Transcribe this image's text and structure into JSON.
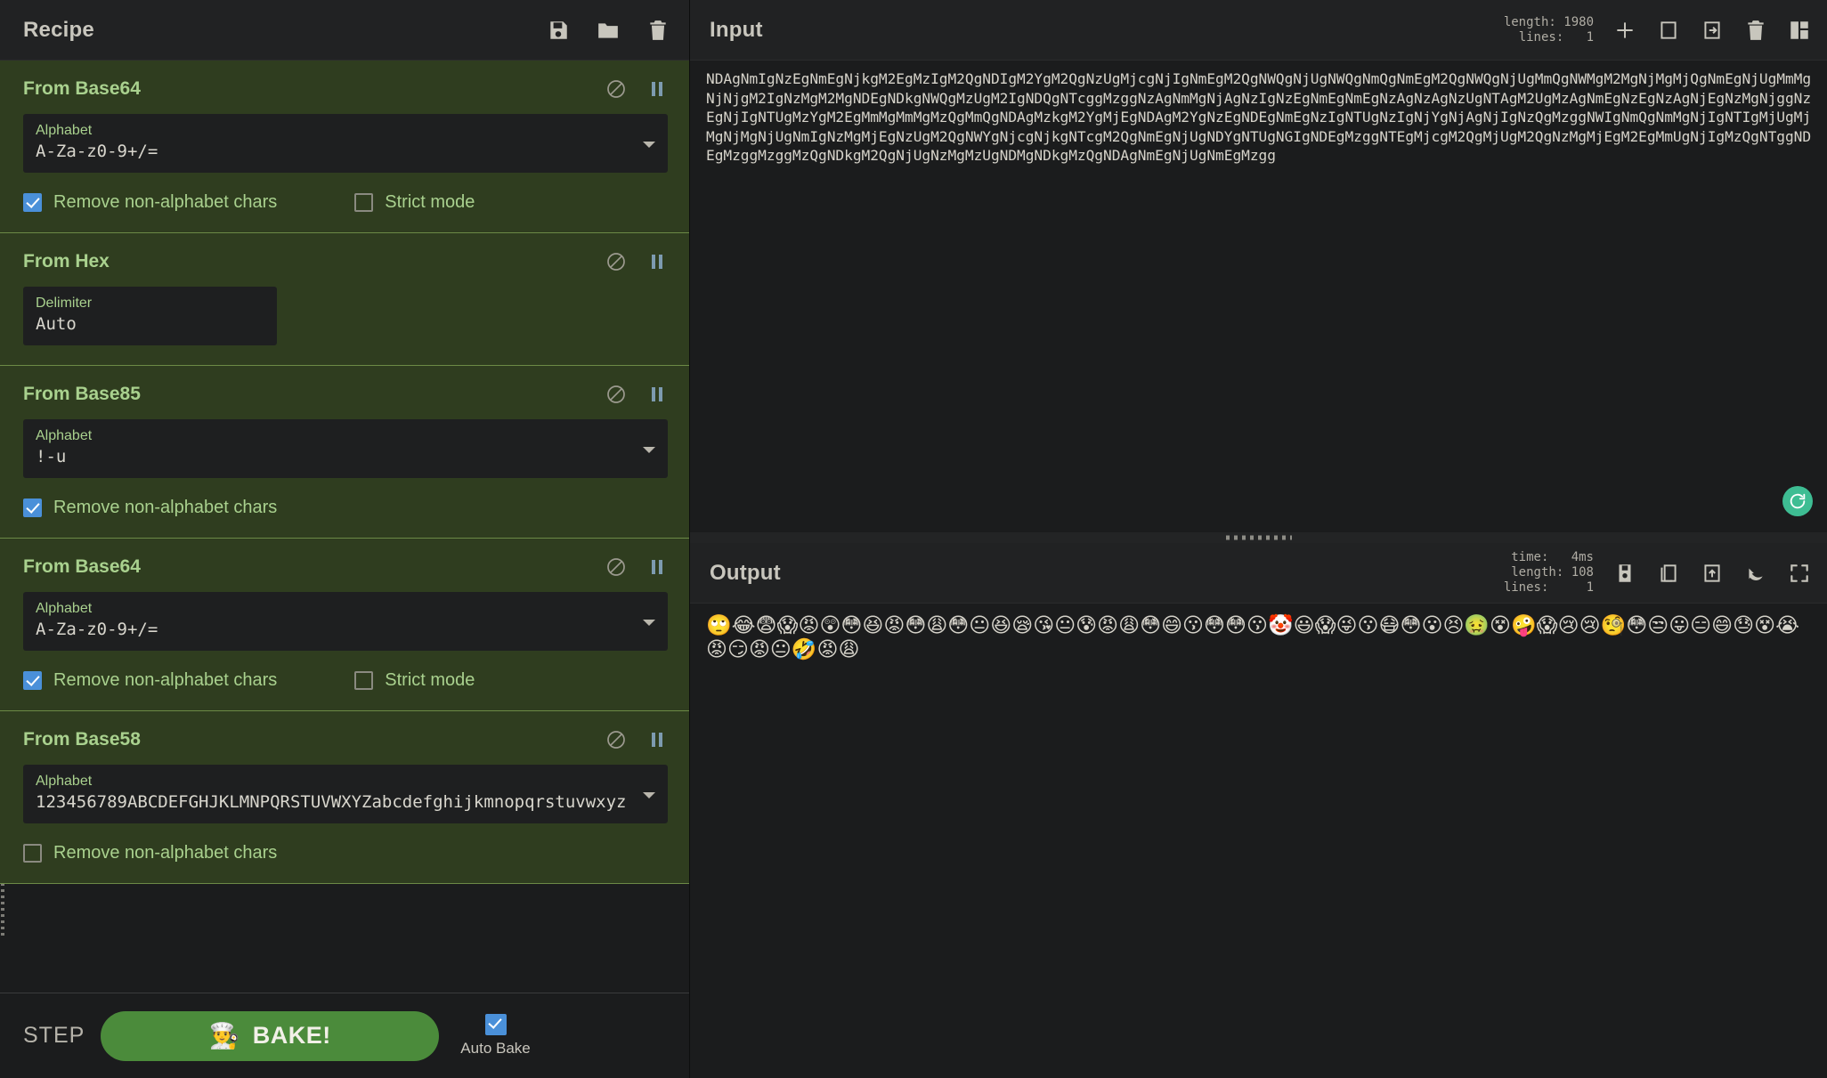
{
  "recipe": {
    "title": "Recipe",
    "header_icons": [
      {
        "name": "save-recipe-icon",
        "glyph": "floppy-disk"
      },
      {
        "name": "load-recipe-icon",
        "glyph": "folder"
      },
      {
        "name": "clear-recipe-icon",
        "glyph": "trash"
      }
    ],
    "operations": [
      {
        "title": "From Base64",
        "disable_icon": "disable-icon",
        "breakpoint_icon": "pause-icon",
        "arg_label": "Alphabet",
        "arg_value": "A-Za-z0-9+/=",
        "has_dropdown": true,
        "checkboxes": [
          {
            "label": "Remove non-alphabet chars",
            "checked": true
          },
          {
            "label": "Strict mode",
            "checked": false
          }
        ]
      },
      {
        "title": "From Hex",
        "disable_icon": "disable-icon",
        "breakpoint_icon": "pause-icon",
        "arg_label": "Delimiter",
        "arg_value": "Auto",
        "has_dropdown": false,
        "checkboxes": []
      },
      {
        "title": "From Base85",
        "disable_icon": "disable-icon",
        "breakpoint_icon": "pause-icon",
        "arg_label": "Alphabet",
        "arg_value": "!-u",
        "has_dropdown": true,
        "checkboxes": [
          {
            "label": "Remove non-alphabet chars",
            "checked": true
          }
        ]
      },
      {
        "title": "From Base64",
        "disable_icon": "disable-icon",
        "breakpoint_icon": "pause-icon",
        "arg_label": "Alphabet",
        "arg_value": "A-Za-z0-9+/=",
        "has_dropdown": true,
        "checkboxes": [
          {
            "label": "Remove non-alphabet chars",
            "checked": true
          },
          {
            "label": "Strict mode",
            "checked": false
          }
        ]
      },
      {
        "title": "From Base58",
        "disable_icon": "disable-icon",
        "breakpoint_icon": "pause-icon",
        "arg_label": "Alphabet",
        "arg_value": "123456789ABCDEFGHJKLMNPQRSTUVWXYZabcdefghijkmnopqrstuvwxyz",
        "has_dropdown": true,
        "checkboxes": [
          {
            "label": "Remove non-alphabet chars",
            "checked": false
          }
        ]
      }
    ],
    "controls": {
      "step_label": "STEP",
      "bake_label": "BAKE!",
      "bake_emoji": "👨‍🍳",
      "autobake_label": "Auto Bake",
      "autobake_checked": true
    }
  },
  "input": {
    "title": "Input",
    "meta": {
      "length_label": "length:",
      "length_value": "1980",
      "lines_label": "lines:",
      "lines_value": "1"
    },
    "icons": [
      {
        "name": "add-input-tab-icon",
        "glyph": "plus"
      },
      {
        "name": "open-folder-icon",
        "glyph": "folder"
      },
      {
        "name": "open-file-as-input-icon",
        "glyph": "file-in"
      },
      {
        "name": "clear-io-icon",
        "glyph": "trash"
      },
      {
        "name": "reset-pane-layout-icon",
        "glyph": "layout"
      }
    ],
    "text": "NDAgNmIgNzEgNmEgNjkgM2EgMzIgM2QgNDIgM2YgM2QgNzUgMjcgNjIgNmEgM2QgNWQgNjUgNWQgNmQgNmEgM2QgNWQgNjUgMmQgNWMgM2MgNjMgMjQgNmEgNjUgMmMgNjNjgM2IgNzMgM2MgNDEgNDkgNWQgMzUgM2IgNDQgNTcggMzggNzAgNmMgNjAgNzIgNzEgNmEgNmEgNzAgNzAgNzUgNTAgM2UgMzAgNmEgNzEgNzAgNjEgNzMgNjggNzEgNjIgNTUgMzYgM2EgMmMgMmMgMzQgMmQgNDAgMzkgM2YgMjEgNDAgM2YgNzEgNDEgNmEgNzIgNTUgNzIgNjYgNjAgNjIgNzQgMzggNWIgNmQgNmMgNjIgNTIgMjUgMjMgNjMgNjUgNmIgNzMgMjEgNzUgM2QgNWYgNjcgNjkgNTcgM2QgNmEgNjUgNDYgNTUgNGIgNDEgMzggNTEgMjcgM2QgMjUgM2QgNzMgMjEgM2EgMmUgNjIgMzQgNTggNDEgMzggMzggMzQgNDkgM2QgNjUgNzMgMzUgNDMgNDkgMzQgNDAgNmEgNjUgNmEgMzgg"
  },
  "output": {
    "title": "Output",
    "meta": {
      "time_label": "time:",
      "time_value": "4ms",
      "length_label": "length:",
      "length_value": "108",
      "lines_label": "lines:",
      "lines_value": "1"
    },
    "icons": [
      {
        "name": "save-output-icon",
        "glyph": "floppy-disk"
      },
      {
        "name": "copy-output-icon",
        "glyph": "copy"
      },
      {
        "name": "replace-input-with-output-icon",
        "glyph": "file-up"
      },
      {
        "name": "undo-bake-icon",
        "glyph": "undo"
      },
      {
        "name": "maximise-output-icon",
        "glyph": "maximise"
      }
    ],
    "text": "🙄😂😨😱😡😲😳😆😡😳😩😳😐😆😪😘😐😰😡😩😳😄😗😳😳😗🤡😃😱😜😗😷😳😮😣🤢😵🤪😱😢😢🧐😳😒😛😑😄😓😵😭😡😏😡😐🤣😡😩",
    "bake_indicator_icon": "baking-in-progress-icon"
  }
}
